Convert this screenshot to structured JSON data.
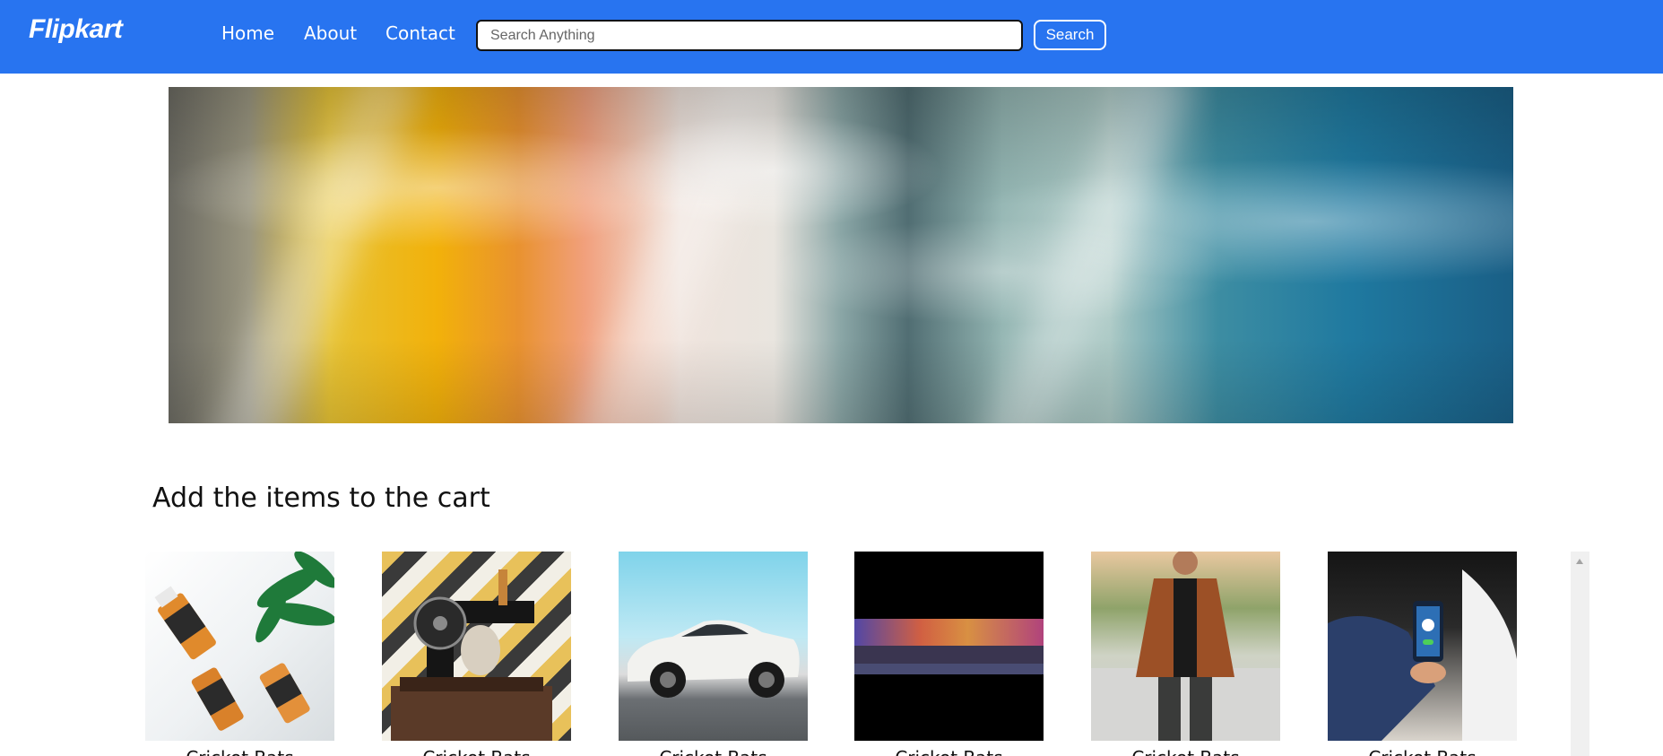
{
  "nav": {
    "logo": "Flipkart",
    "links": [
      "Home",
      "About",
      "Contact"
    ],
    "search_placeholder": "Search Anything",
    "search_button": "Search"
  },
  "hero": {
    "icon": "hero-banner-image"
  },
  "section": {
    "title": "Add the items to the cart"
  },
  "products": [
    {
      "caption": "Cricket Bats",
      "icon": "product-bottles-image"
    },
    {
      "caption": "Cricket Bats",
      "icon": "product-sewing-machine-image"
    },
    {
      "caption": "Cricket Bats",
      "icon": "product-car-image"
    },
    {
      "caption": "Cricket Bats",
      "icon": "product-laptop-image"
    },
    {
      "caption": "Cricket Bats",
      "icon": "product-jacket-image"
    },
    {
      "caption": "Cricket Bats",
      "icon": "product-phone-image"
    }
  ],
  "colors": {
    "navbar": "#2874f0",
    "text": "#111111",
    "background": "#ffffff"
  }
}
